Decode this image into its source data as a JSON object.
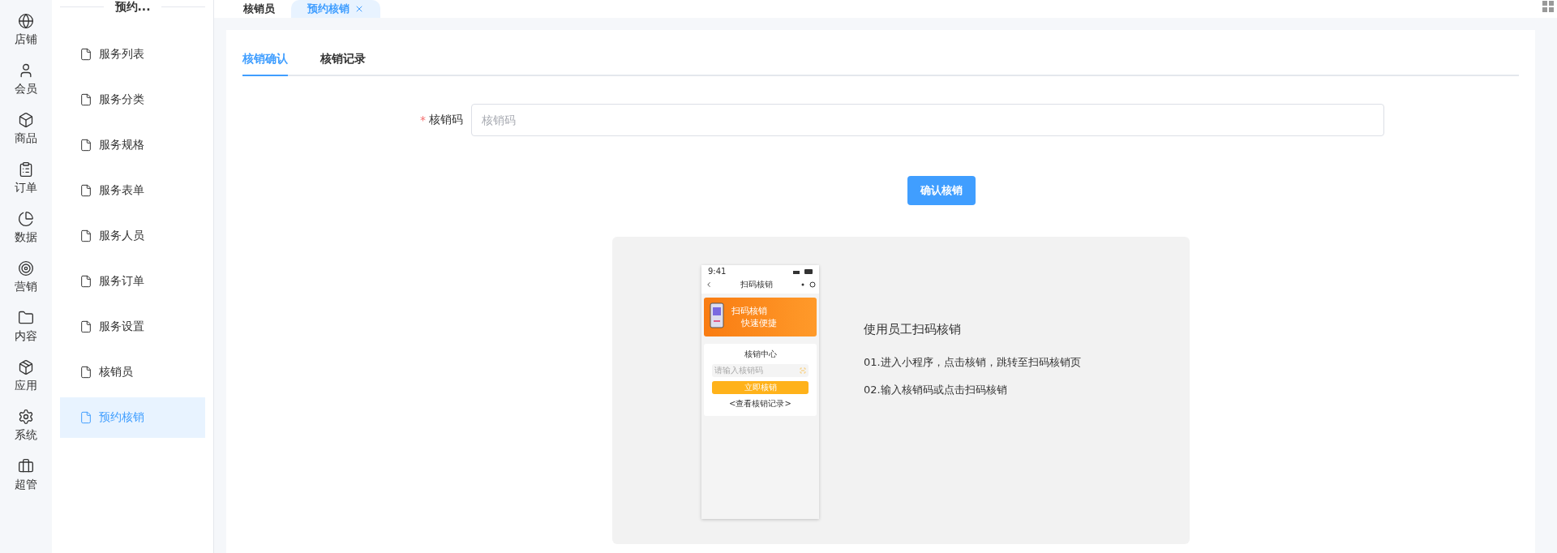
{
  "rail": [
    {
      "label": "店铺",
      "selected": false
    },
    {
      "label": "会员",
      "selected": false
    },
    {
      "label": "商品",
      "selected": false
    },
    {
      "label": "订单",
      "selected": false
    },
    {
      "label": "数据",
      "selected": false
    },
    {
      "label": "营销",
      "selected": false
    },
    {
      "label": "内容",
      "selected": false
    },
    {
      "label": "应用",
      "selected": false
    },
    {
      "label": "系统",
      "selected": false
    },
    {
      "label": "超管",
      "selected": false
    }
  ],
  "submenu": {
    "title": "预约...",
    "items": [
      {
        "label": "服务列表",
        "selected": false
      },
      {
        "label": "服务分类",
        "selected": false
      },
      {
        "label": "服务规格",
        "selected": false
      },
      {
        "label": "服务表单",
        "selected": false
      },
      {
        "label": "服务人员",
        "selected": false
      },
      {
        "label": "服务订单",
        "selected": false
      },
      {
        "label": "服务设置",
        "selected": false
      },
      {
        "label": "核销员",
        "selected": false
      },
      {
        "label": "预约核销",
        "selected": true
      }
    ]
  },
  "page_tabs": [
    {
      "label": "核销员",
      "selected": false,
      "closable": false
    },
    {
      "label": "预约核销",
      "selected": true,
      "closable": true
    }
  ],
  "content_tabs": [
    {
      "label": "核销确认",
      "selected": true
    },
    {
      "label": "核销记录",
      "selected": false
    }
  ],
  "form": {
    "label": "核销码",
    "required_mark": "*",
    "placeholder": "核销码",
    "submit": "确认核销"
  },
  "guide": {
    "phone": {
      "time": "9:41",
      "title": "扫码核销",
      "banner_line_1": "扫码核销",
      "banner_line_2": "快速便捷",
      "card_title": "核销中心",
      "placeholder": "请输入核销码",
      "button": "立即核销",
      "link": "<查看核销记录>"
    },
    "heading": "使用员工扫码核销",
    "steps": [
      "01.进入小程序，点击核销，跳转至扫码核销页",
      "02.输入核销码或点击扫码核销"
    ]
  }
}
